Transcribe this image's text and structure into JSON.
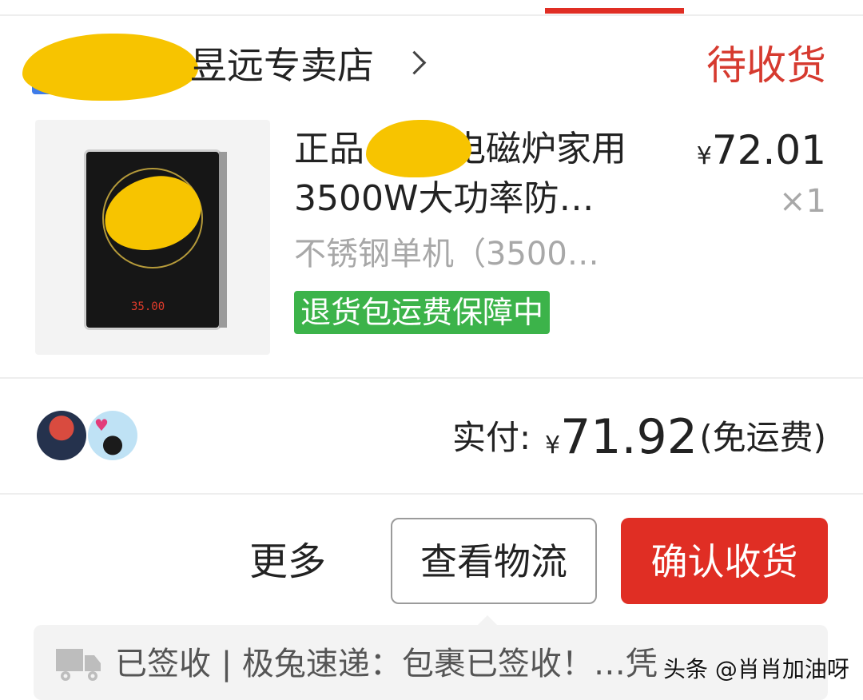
{
  "store": {
    "name": "昱远专卖店",
    "status": "待收货"
  },
  "product": {
    "title_line1": "正品",
    "title_line1_cont": "电磁炉家用",
    "title_line2": "3500W大功率防…",
    "variant": "不锈钢单机（3500…",
    "return_badge": "退货包运费保障中",
    "price": "72.01",
    "currency": "¥",
    "quantity": "×1",
    "thumb_display": "35.00"
  },
  "payment": {
    "label": "实付:",
    "currency": "¥",
    "amount": "71.92",
    "shipping": "(免运费)"
  },
  "actions": {
    "more": "更多",
    "view_logistics": "查看物流",
    "confirm_receipt": "确认收货"
  },
  "logistics": {
    "status_text": "已签收 | 极兔速递：包裹已签收！…凭"
  },
  "watermark": "头条 @肖肖加油呀",
  "colors": {
    "accent_red": "#e02e24",
    "status_red": "#d63a2f",
    "badge_green": "#3cb34a"
  }
}
